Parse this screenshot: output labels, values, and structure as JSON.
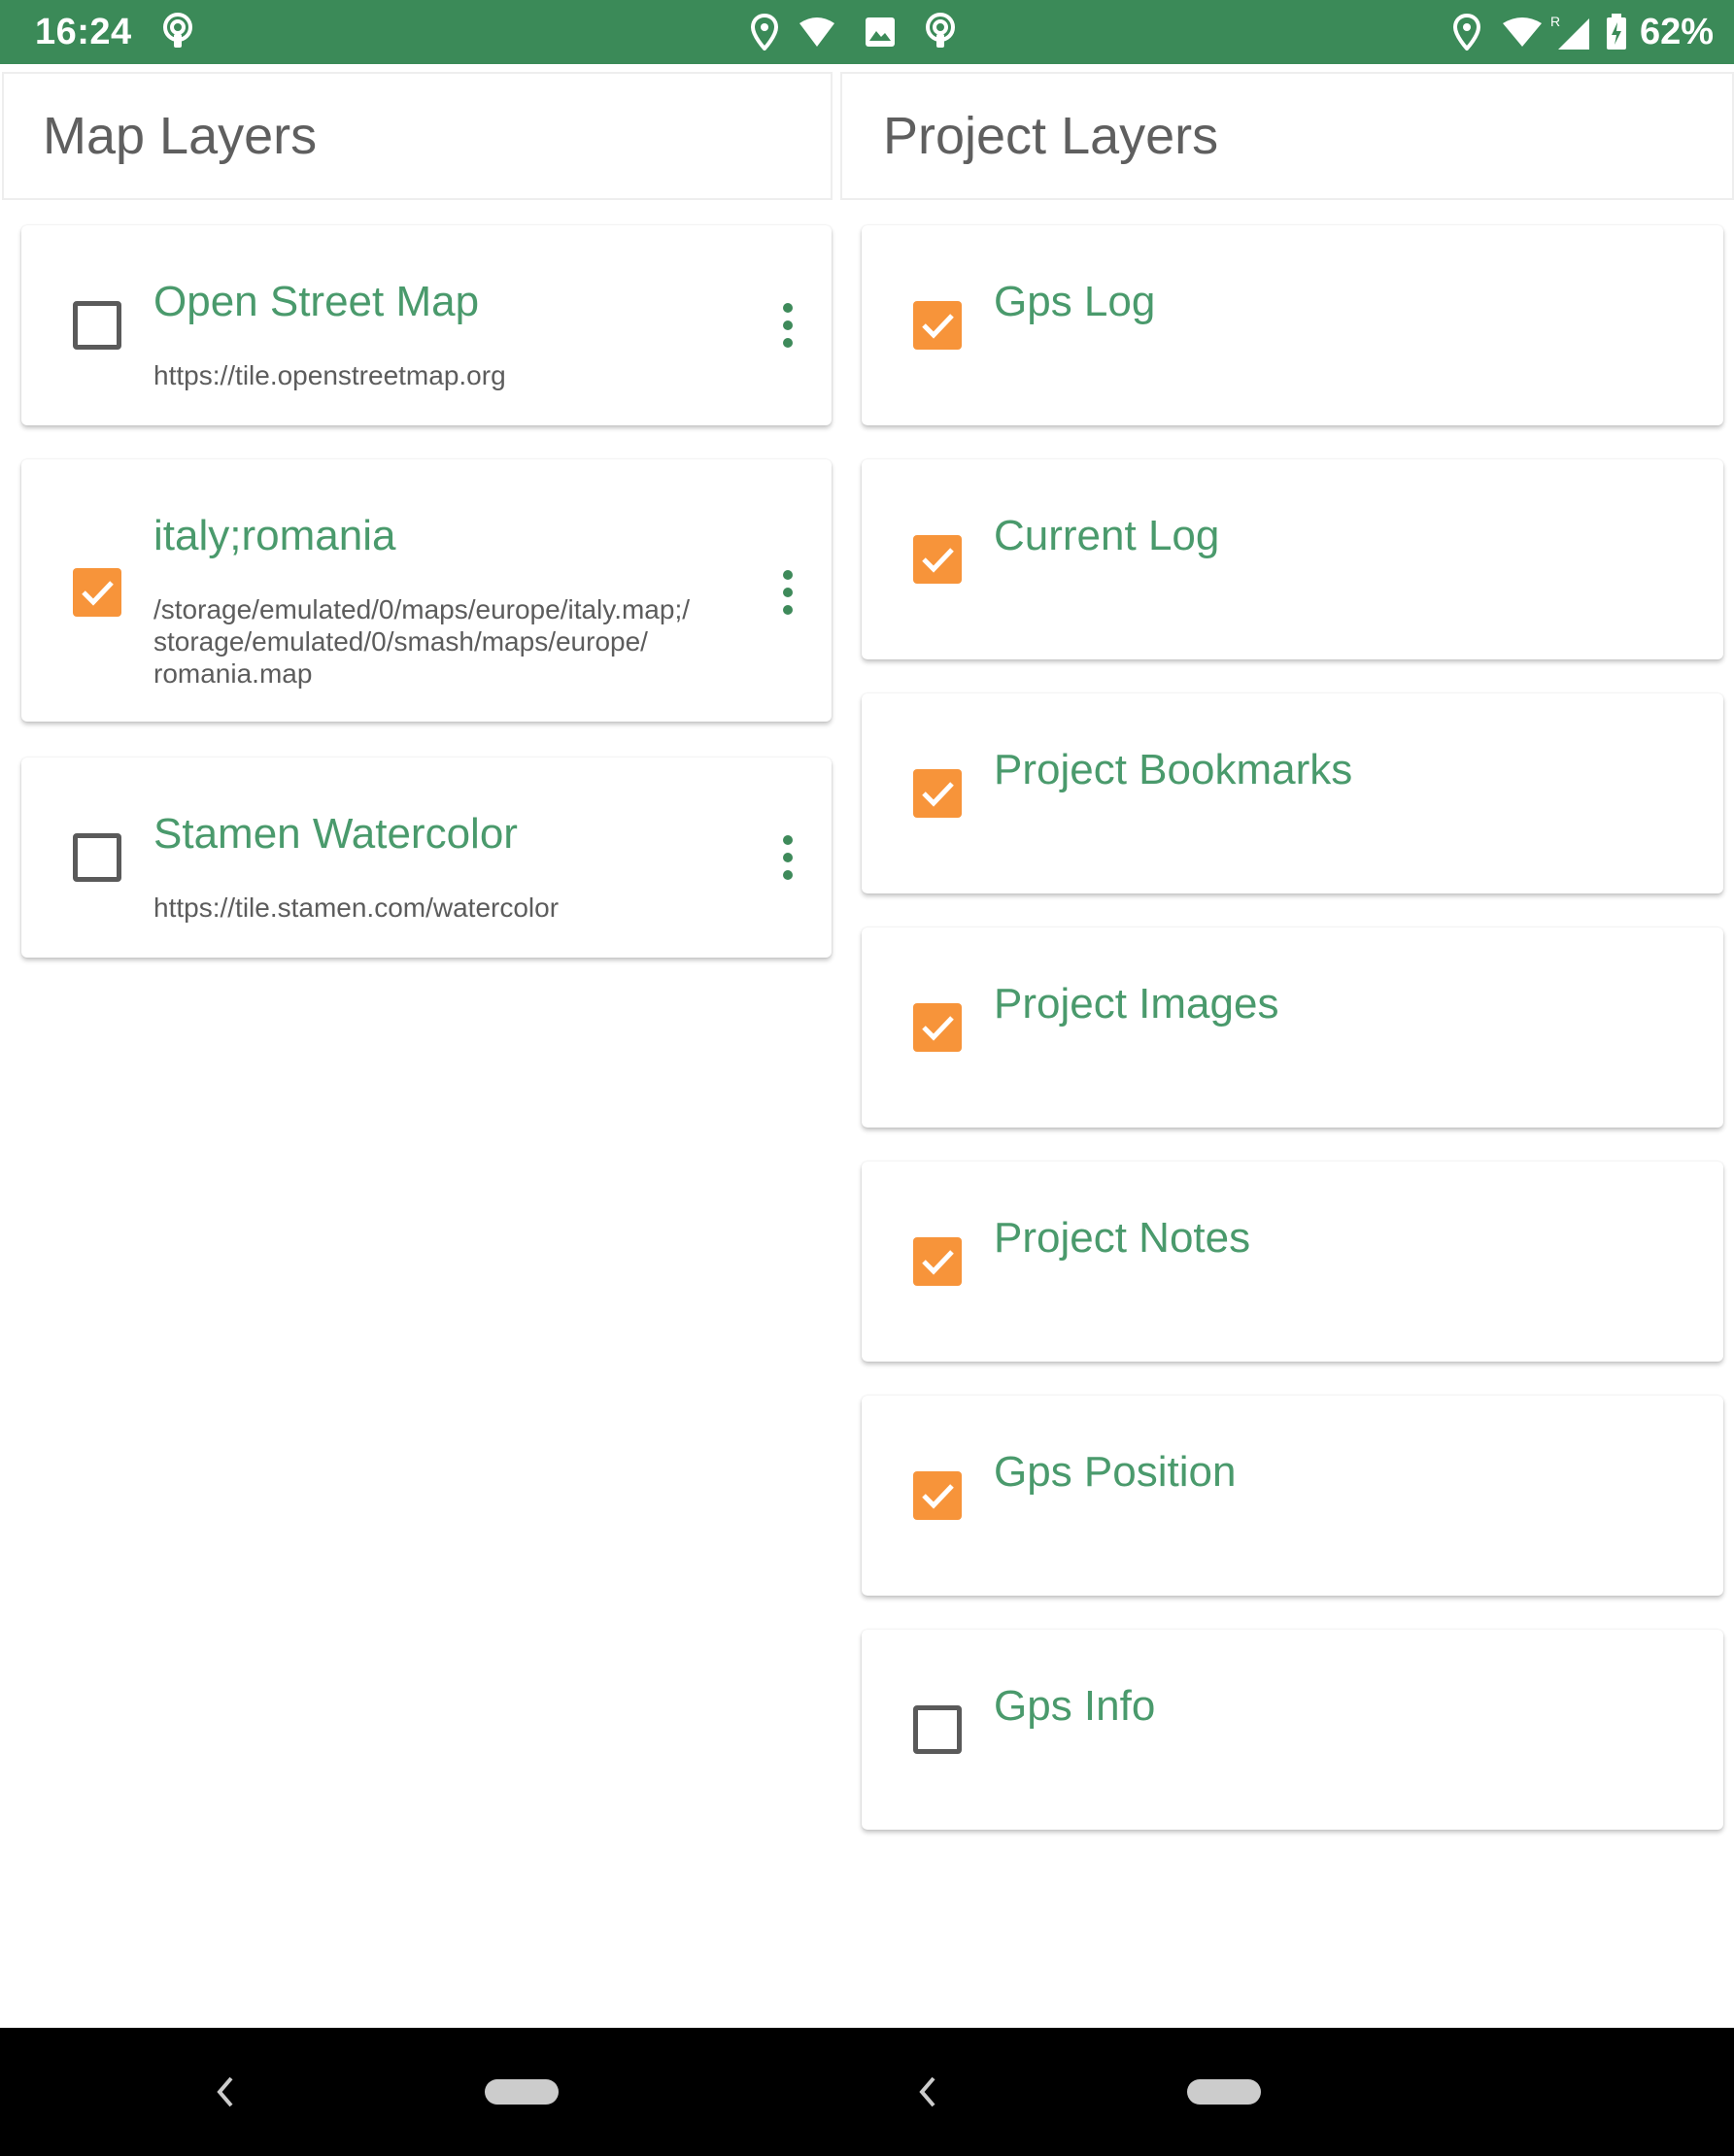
{
  "status_bar": {
    "time": "16:24",
    "battery": "62%",
    "icons": [
      "podcast-icon",
      "location-icon",
      "wifi-icon",
      "image-icon",
      "podcast-icon",
      "location-icon",
      "wifi-icon",
      "roaming-signal-icon",
      "battery-charging-icon"
    ]
  },
  "left_panel": {
    "title": "Map Layers",
    "items": [
      {
        "name": "Open Street Map",
        "path": "https://tile.openstreetmap.org",
        "checked": false
      },
      {
        "name": "italy;romania",
        "path": "/storage/emulated/0/maps/europe/italy.map;/\nstorage/emulated/0/smash/maps/europe/\nromania.map",
        "checked": true
      },
      {
        "name": "Stamen Watercolor",
        "path": "https://tile.stamen.com/watercolor",
        "checked": false
      }
    ]
  },
  "right_panel": {
    "title": "Project Layers",
    "items": [
      {
        "name": "Gps Log",
        "checked": true
      },
      {
        "name": "Current Log",
        "checked": true
      },
      {
        "name": "Project Bookmarks",
        "checked": true
      },
      {
        "name": "Project Images",
        "checked": true
      },
      {
        "name": "Project Notes",
        "checked": true
      },
      {
        "name": "Gps Position",
        "checked": true
      },
      {
        "name": "Gps Info",
        "checked": false
      }
    ]
  },
  "colors": {
    "status_bar": "#3b8a58",
    "accent_green": "#4a9a6c",
    "checkbox_checked": "#f7943a",
    "menu_dots": "#3e8a5a"
  }
}
